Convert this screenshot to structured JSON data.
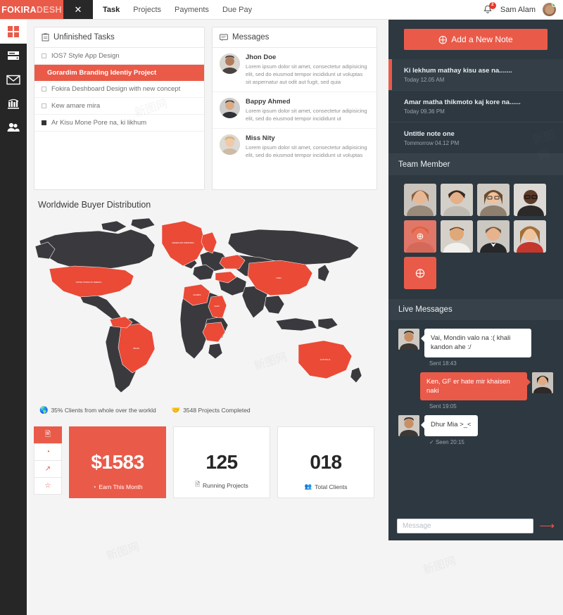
{
  "brand": {
    "strong": "FOKIRA",
    "dim": "DESH",
    "toggle_icon": "close-icon",
    "toggle_label": "✕"
  },
  "nav": {
    "tabs": [
      "Task",
      "Projects",
      "Payments",
      "Due Pay"
    ]
  },
  "topbar": {
    "notification_icon": "bell-icon",
    "notification_count": "2",
    "user_name": "Sam Alam"
  },
  "rail": {
    "items": [
      {
        "name": "dashboard-grid-icon",
        "glyph": ""
      },
      {
        "name": "server-list-icon",
        "glyph": "≡"
      },
      {
        "name": "mail-icon",
        "glyph": "✉"
      },
      {
        "name": "analytics-bar-chart-icon",
        "glyph": "ᴵ"
      },
      {
        "name": "users-icon",
        "glyph": "●●"
      }
    ]
  },
  "tasks": {
    "title": "Unfinished Tasks",
    "icon": "clipboard-icon",
    "items": [
      {
        "label": "IOS7 Style App Design",
        "checked": false,
        "highlighted": false
      },
      {
        "label": "Gorardim Branding Identiy Project",
        "checked": false,
        "highlighted": true
      },
      {
        "label": "Fokira Deshboard Design with new concept",
        "checked": false,
        "highlighted": false
      },
      {
        "label": "Kew amare mira",
        "checked": false,
        "highlighted": false
      },
      {
        "label": "Ar Kisu Mone Pore na, ki likhum",
        "checked": true,
        "highlighted": false
      }
    ]
  },
  "messages": {
    "title": "Messages",
    "icon": "comment-icon",
    "items": [
      {
        "name": "Jhon Doe",
        "text": "Lorem ipsum dolor sit amet, consectetur adipisicing elit, sed do eiusmod tempor incididunt ut voluptas sit aspernatur aut odit aut fugit, sed quia"
      },
      {
        "name": "Bappy Ahmed",
        "text": "Lorem ipsum dolor sit amet, consectetur adipisicing elit, sed do eiusmod tempor incididunt ut"
      },
      {
        "name": "Miss Nity",
        "text": "Lorem ipsum dolor sit amet, consectetur adipisicing elit, sed do eiusmod tempor incididunt ut voluptas"
      }
    ]
  },
  "map": {
    "title": "Worldwide Buyer Distribution",
    "legend": [
      {
        "icon": "globe-icon",
        "glyph": "⊕",
        "text": "35% Clients from whole over the workld"
      },
      {
        "icon": "handshake-icon",
        "glyph": "☞",
        "text": "3548 Projects Completed"
      }
    ],
    "base_color": "#3a3a3e",
    "highlight_color": "#ea4a36",
    "ocean_color": "#f4f4f4",
    "highlighted_countries": [
      "United States of America",
      "Greenland (Denmark)",
      "Sweden",
      "Norway",
      "Ukraine",
      "Algeria",
      "Chad",
      "Democratic Republic of the Congo",
      "China",
      "Australia",
      "Brazil",
      "Venezuela",
      "Mexico",
      "Turkey"
    ]
  },
  "stats": {
    "icon_strip": [
      {
        "name": "report-icon",
        "glyph": "☰",
        "active": true
      },
      {
        "name": "pie-chart-icon",
        "glyph": "◔",
        "active": false
      },
      {
        "name": "line-chart-icon",
        "glyph": "↗",
        "active": false
      },
      {
        "name": "star-icon",
        "glyph": "☆",
        "active": false
      }
    ],
    "cards": [
      {
        "value": "$1583",
        "label": "Earn This Month",
        "icon": "clock-icon",
        "glyph": "◔",
        "accent": true
      },
      {
        "value": "125",
        "label": "Running Projects",
        "icon": "briefcase-icon",
        "glyph": "☰",
        "accent": false
      },
      {
        "value": "018",
        "label": "Total Clients",
        "icon": "users-icon",
        "glyph": "●●",
        "accent": false
      }
    ]
  },
  "right": {
    "add_note_label": "Add a New Note",
    "add_note_icon": "plus-circle-icon",
    "notes": [
      {
        "title": "Ki lekhum mathay kisu ase na.......",
        "date": "Today 12.05 AM",
        "active": true
      },
      {
        "title": "Amar matha thikmoto kaj kore na......",
        "date": "Today 09.36 PM",
        "active": false
      },
      {
        "title": "Untitle note one",
        "date": "Tommorrow 04.12 PM",
        "active": false
      }
    ],
    "team_title": "Team Member",
    "team_count": 8,
    "add_member_icon": "plus-circle-icon",
    "live_title": "Live Messages",
    "chat": [
      {
        "dir": "in",
        "text": "Vai, Mondin valo na :( khali kandon ahe :/",
        "meta": "Sent 18:43",
        "seen": false
      },
      {
        "dir": "out",
        "text": "Ken, GF er hate mir khaisen naki",
        "meta": "Sent 19:05",
        "seen": false
      },
      {
        "dir": "in",
        "text": "Dhur Mia >_<",
        "meta": "Seen 20:15",
        "seen": true
      }
    ],
    "composer_placeholder": "Message",
    "send_icon": "send-arrow-icon"
  },
  "colors": {
    "accent": "#ea5a49",
    "dark_panel": "#2e3840",
    "rail": "#262626"
  }
}
